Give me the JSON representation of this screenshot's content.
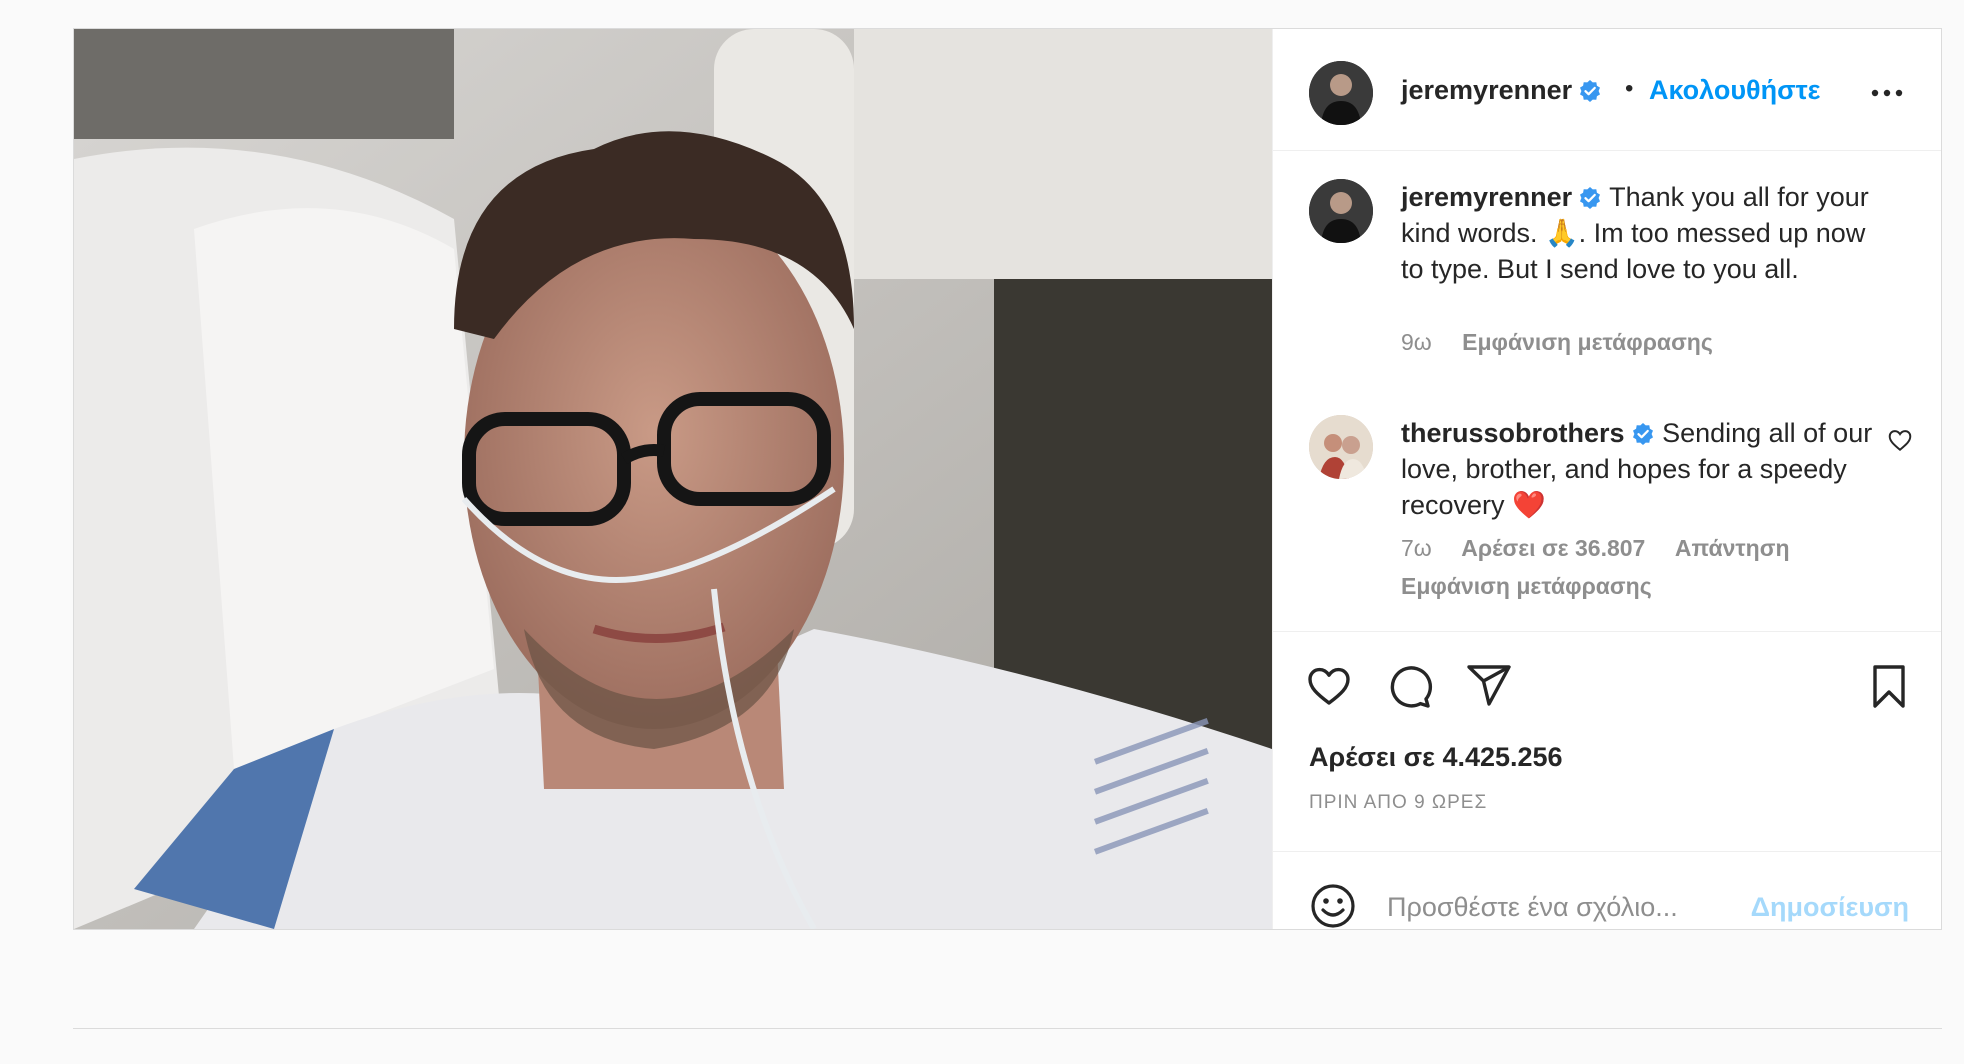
{
  "post": {
    "author": "jeremyrenner",
    "separator": "•",
    "follow_label": "Ακολουθήστε",
    "caption": {
      "username": "jeremyrenner",
      "text": "Thank you all for your kind words. 🙏. Im too messed up now to type. But I send love to you all.",
      "time": "9ω",
      "translate": "Εμφάνιση μετάφρασης"
    },
    "comments": [
      {
        "username": "therussobrothers",
        "text": "Sending all of our love, brother, and hopes for a speedy recovery ❤️",
        "time": "7ω",
        "likes": "Αρέσει σε 36.807",
        "reply": "Απάντηση",
        "translate": "Εμφάνιση μετάφρασης"
      }
    ],
    "likes_text": "Αρέσει σε 4.425.256",
    "posted_ago": "ΠΡΙΝ ΑΠΟ 9 ΩΡΕΣ",
    "comment_placeholder": "Προσθέστε ένα σχόλιο...",
    "publish_label": "Δημοσίευση"
  },
  "icons": [
    "verified-badge-icon",
    "more-options-icon",
    "heart-icon",
    "comment-icon",
    "share-icon",
    "bookmark-icon",
    "emoji-icon"
  ],
  "colors": {
    "accent": "#0095f6",
    "verified": "#3897f0",
    "heart_red": "#ed4956"
  }
}
